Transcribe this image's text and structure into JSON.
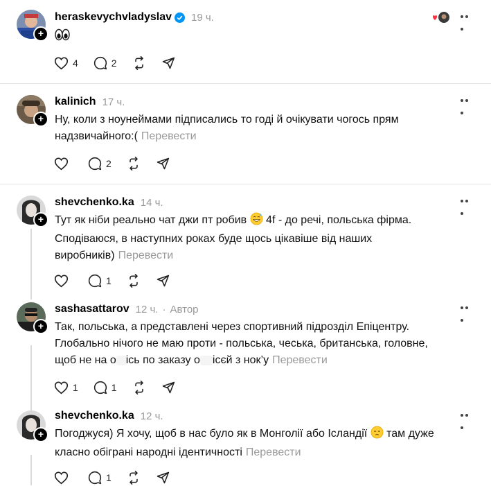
{
  "posts": [
    {
      "username": "heraskevychvladyslav",
      "verified": true,
      "time": "19 ч.",
      "text": "",
      "emoji": "eyes",
      "likes": "4",
      "replies": "2"
    },
    {
      "username": "kalinich",
      "time": "17 ч.",
      "text": "Ну, коли з ноунеймами підписались то годі й очікувати чогось прям надзвичайного:(",
      "translate": "Перевести",
      "likes": "",
      "replies": "2"
    },
    {
      "username": "shevchenko.ka",
      "time": "14 ч.",
      "text_a": "Тут як ніби реально чат джи пт робив ",
      "text_b": " 4f - до речі, польська фірма. Сподіваюся, в наступних роках буде щось цікавіше від наших виробників)",
      "translate": "Перевести",
      "likes": "",
      "replies": "1"
    },
    {
      "username": "sashasattarov",
      "time": "12 ч.",
      "author": "Автор",
      "text_a": "Так, польська, а представлені через спортивний підрозділ Епіцентру. Глобально нічого не маю проти - польська, чеська, британська, головне, щоб не на о",
      "text_b": "ісь по заказу о",
      "text_c": "ісєй з нок’у",
      "translate": "Перевести",
      "likes": "1",
      "replies": "1"
    },
    {
      "username": "shevchenko.ka",
      "time": "12 ч.",
      "text_a": "Погоджуся) Я хочу, щоб в нас було як в Монголії або Ісландії ",
      "text_b": " там дуже класно обіграні народні ідентичності",
      "translate": "Перевести",
      "likes": "",
      "replies": "1"
    }
  ]
}
